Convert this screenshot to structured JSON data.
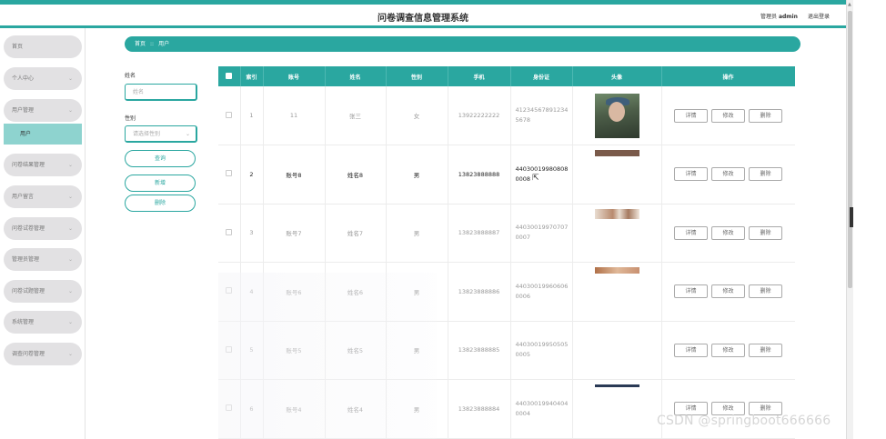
{
  "header": {
    "title": "问卷调查信息管理系统",
    "admin_prefix": "管理员",
    "admin_name": "admin",
    "logout": "退出登录"
  },
  "sidebar": {
    "items": [
      {
        "label": "首页",
        "chevron": false
      },
      {
        "label": "个人中心",
        "chevron": true
      },
      {
        "label": "用户管理",
        "chevron": true
      },
      {
        "label": "用户",
        "sub": true
      },
      {
        "label": "问卷结果管理",
        "chevron": true
      },
      {
        "label": "用户留言",
        "chevron": true
      },
      {
        "label": "问卷试卷管理",
        "chevron": true
      },
      {
        "label": "管理员管理",
        "chevron": true
      },
      {
        "label": "问卷试题管理",
        "chevron": true
      },
      {
        "label": "系统管理",
        "chevron": true
      },
      {
        "label": "调查问卷管理",
        "chevron": true
      }
    ],
    "chevron_glyph": "⌄"
  },
  "breadcrumb": {
    "home": "首页",
    "separator": "::",
    "current": "用户"
  },
  "search": {
    "name_label": "姓名",
    "name_placeholder": "姓名",
    "gender_label": "性别",
    "gender_placeholder": "请选择性别",
    "query_button": "查询",
    "add_button": "新增",
    "delete_button": "删除"
  },
  "table": {
    "columns": [
      "索引",
      "账号",
      "姓名",
      "性别",
      "手机",
      "身份证",
      "头像",
      "操作"
    ],
    "rows": [
      {
        "index": "1",
        "account": "11",
        "name": "张三",
        "gender": "女",
        "phone": "13922222222",
        "idcard": "412345678912345678",
        "avatar": "full"
      },
      {
        "index": "2",
        "account": "账号8",
        "name": "姓名8",
        "gender": "男",
        "phone": "13823888888",
        "idcard": "440300199808080008",
        "avatar": "strip"
      },
      {
        "index": "3",
        "account": "账号7",
        "name": "姓名7",
        "gender": "男",
        "phone": "13823888887",
        "idcard": "440300199707070007",
        "avatar": "strip"
      },
      {
        "index": "4",
        "account": "账号6",
        "name": "姓名6",
        "gender": "男",
        "phone": "13823888886",
        "idcard": "440300199606060006",
        "avatar": "strip"
      },
      {
        "index": "5",
        "account": "账号5",
        "name": "姓名5",
        "gender": "男",
        "phone": "13823888885",
        "idcard": "440300199505050005",
        "avatar": "none"
      },
      {
        "index": "6",
        "account": "账号4",
        "name": "姓名4",
        "gender": "男",
        "phone": "13823888884",
        "idcard": "440300199404040004",
        "avatar": "strip"
      }
    ],
    "actions": {
      "detail": "详情",
      "edit": "修改",
      "delete": "删除"
    }
  },
  "watermark": "CSDN @springboot666666",
  "colors": {
    "primary": "#2aa7a0",
    "menu_bg": "#e2e1e3",
    "menu_active": "#8ed3cf"
  }
}
